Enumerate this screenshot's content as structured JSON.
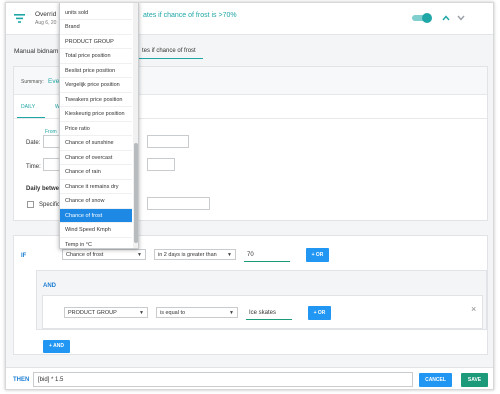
{
  "header": {
    "title_prefix": "Overrid",
    "date": "Aug 6, 20",
    "title_suffix": "ates if chance of frost is >70%"
  },
  "subheader": {
    "left": "Manual bidnam",
    "right": "tes if chance of frost"
  },
  "summary": {
    "label": "Summary:",
    "value": "Eve"
  },
  "tabs": {
    "daily": "DAILY",
    "weekly": "WE"
  },
  "schedule": {
    "from": "From",
    "date_label": "Date:",
    "time_label": "Time:",
    "daily_between": "Daily between:",
    "specific_prefix": "Specific t"
  },
  "dropdown": {
    "items": [
      "units sold",
      "Brand",
      "PRODUCT GROUP",
      "Total price position",
      "Beslist price position",
      "Vergelijk price position",
      "Tweakers price position",
      "Kieskeurig price position",
      "Price ratio",
      "Chance of sunshine",
      "Chance of overcast",
      "Chance of rain",
      "Chance it remains dry",
      "Chance of snow",
      "Chance of frost",
      "Wind Speed Kmph",
      "Temp in °C"
    ],
    "selected": "Chance of frost"
  },
  "if_block": {
    "label": "IF",
    "field": "Chance of frost",
    "operator": "in 2 days is greater than",
    "value": "70",
    "or_button": "+ OR"
  },
  "and_block": {
    "label": "AND",
    "field": "PRODUCT GROUP",
    "operator": "is equal to",
    "value": "Ice skates",
    "or_button": "+ OR",
    "remove": "×"
  },
  "add_and_button": "+ AND",
  "then_block": {
    "label": "THEN",
    "expression": "[bid] * 1.5",
    "cancel": "CANCEL",
    "save": "SAVE"
  },
  "colors": {
    "accent": "#1fa6a6",
    "blue": "#2196f3",
    "selected": "#1e88e5",
    "save": "#1d9a7a"
  },
  "icons": [
    "filter-icon",
    "toggle-switch",
    "chevron-up-icon",
    "chevron-down-icon",
    "close-icon",
    "select-caret-icon"
  ]
}
